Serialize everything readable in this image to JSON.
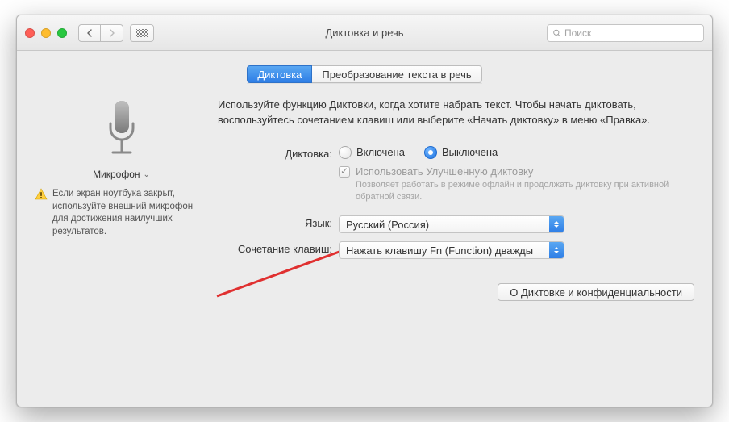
{
  "window": {
    "title": "Диктовка и речь"
  },
  "search": {
    "placeholder": "Поиск"
  },
  "tabs": {
    "dictation": "Диктовка",
    "tts": "Преобразование текста в речь"
  },
  "left": {
    "mic_label": "Микрофон",
    "warning": "Если экран ноутбука закрыт, используйте внешний микрофон для достижения наилучших результатов."
  },
  "intro": "Используйте функцию Диктовки, когда хотите набрать текст. Чтобы начать диктовать, воспользуйтесь сочетанием клавиш или выберите «Начать диктовку» в меню «Правка».",
  "form": {
    "dictation_label": "Диктовка:",
    "on": "Включена",
    "off": "Выключена",
    "enhanced_label": "Использовать Улучшенную диктовку",
    "enhanced_desc": "Позволяет работать в режиме офлайн и продолжать диктовку при активной обратной связи.",
    "language_label": "Язык:",
    "language_value": "Русский (Россия)",
    "shortcut_label": "Сочетание клавиш:",
    "shortcut_value": "Нажать клавишу Fn (Function) дважды"
  },
  "footer": {
    "about_btn": "О Диктовке и конфиденциальности"
  }
}
